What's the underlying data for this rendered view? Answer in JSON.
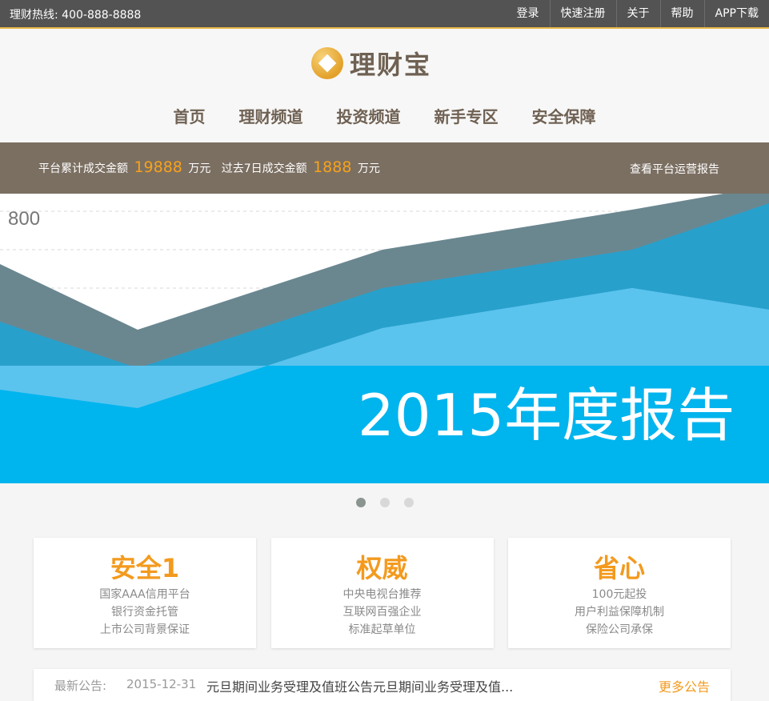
{
  "topbar": {
    "hotline": "理财热线: 400-888-8888",
    "links": [
      "登录",
      "快速注册",
      "关于",
      "帮助",
      "APP下载"
    ]
  },
  "header": {
    "logo_text": "理财宝",
    "nav": [
      "首页",
      "理财频道",
      "投资频道",
      "新手专区",
      "安全保障"
    ]
  },
  "stats": {
    "total_label": "平台累计成交金额",
    "total_value": "19888",
    "total_unit": "万元",
    "week_label": "过去7日成交金额",
    "week_value": "1888",
    "week_unit": "万元",
    "report_link": "查看平台运营报告"
  },
  "banner": {
    "axis_label": "800",
    "title": "2015年度报告",
    "slides": 3,
    "active_slide": 0
  },
  "features": [
    {
      "title": "安全1",
      "lines": [
        "国家AAA信用平台",
        "银行资金托管",
        "上市公司背景保证"
      ]
    },
    {
      "title": "权威",
      "lines": [
        "中央电视台推荐",
        "互联网百强企业",
        "标准起草单位"
      ]
    },
    {
      "title": "省心",
      "lines": [
        "100元起投",
        "用户利益保障机制",
        "保险公司承保"
      ]
    }
  ],
  "notice": {
    "label": "最新公告:",
    "date": "2015-12-31",
    "text": "元旦期间业务受理及值班公告元旦期间业务受理及值...",
    "more": "更多公告"
  },
  "colors": {
    "topbar": "#535353",
    "brand_text": "#6f6153",
    "stats_bar": "#7b6f62",
    "accent_orange": "#f39a1e",
    "banner_blue": "#00b4ee"
  }
}
